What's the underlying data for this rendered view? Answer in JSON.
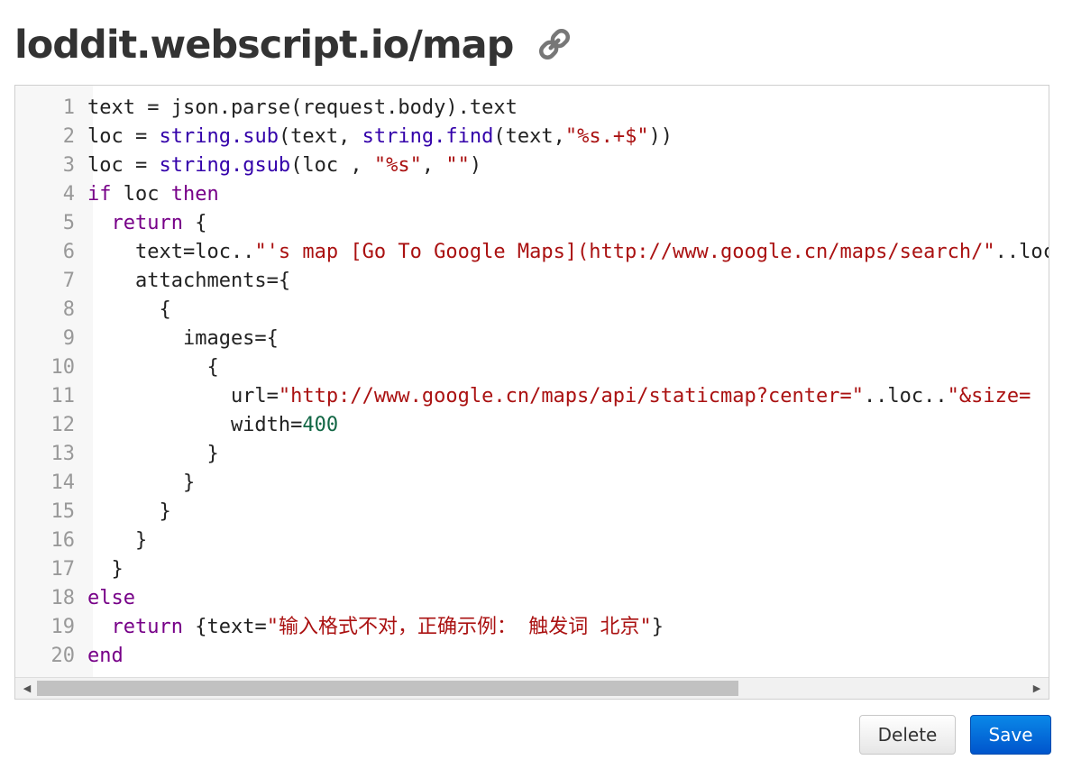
{
  "header": {
    "title": "loddit.webscript.io/map",
    "link_icon": "link-icon"
  },
  "editor": {
    "line_numbers": [
      "1",
      "2",
      "3",
      "4",
      "5",
      "6",
      "7",
      "8",
      "9",
      "10",
      "11",
      "12",
      "13",
      "14",
      "15",
      "16",
      "17",
      "18",
      "19",
      "20"
    ],
    "lines": [
      [
        {
          "t": "text = json.parse(request.body).text",
          "c": ""
        }
      ],
      [
        {
          "t": "loc = ",
          "c": ""
        },
        {
          "t": "string.sub",
          "c": "fn"
        },
        {
          "t": "(text, ",
          "c": ""
        },
        {
          "t": "string.find",
          "c": "fn"
        },
        {
          "t": "(text,",
          "c": ""
        },
        {
          "t": "\"%s.+$\"",
          "c": "str"
        },
        {
          "t": "))",
          "c": ""
        }
      ],
      [
        {
          "t": "loc = ",
          "c": ""
        },
        {
          "t": "string.gsub",
          "c": "fn"
        },
        {
          "t": "(loc , ",
          "c": ""
        },
        {
          "t": "\"%s\"",
          "c": "str"
        },
        {
          "t": ", ",
          "c": ""
        },
        {
          "t": "\"\"",
          "c": "str"
        },
        {
          "t": ")",
          "c": ""
        }
      ],
      [
        {
          "t": "if",
          "c": "kw"
        },
        {
          "t": " loc ",
          "c": ""
        },
        {
          "t": "then",
          "c": "kw"
        }
      ],
      [
        {
          "t": "  ",
          "c": ""
        },
        {
          "t": "return",
          "c": "kw"
        },
        {
          "t": " {",
          "c": ""
        }
      ],
      [
        {
          "t": "    text=loc..",
          "c": ""
        },
        {
          "t": "\"'s map [Go To Google Maps](http://www.google.cn/maps/search/\"",
          "c": "str"
        },
        {
          "t": "..loc..",
          "c": ""
        }
      ],
      [
        {
          "t": "    attachments={",
          "c": ""
        }
      ],
      [
        {
          "t": "      {",
          "c": ""
        }
      ],
      [
        {
          "t": "        images={",
          "c": ""
        }
      ],
      [
        {
          "t": "          {",
          "c": ""
        }
      ],
      [
        {
          "t": "            url=",
          "c": ""
        },
        {
          "t": "\"http://www.google.cn/maps/api/staticmap?center=\"",
          "c": "str"
        },
        {
          "t": "..loc..",
          "c": ""
        },
        {
          "t": "\"&size=",
          "c": "str"
        }
      ],
      [
        {
          "t": "            width=",
          "c": ""
        },
        {
          "t": "400",
          "c": "num"
        }
      ],
      [
        {
          "t": "          }",
          "c": ""
        }
      ],
      [
        {
          "t": "        }",
          "c": ""
        }
      ],
      [
        {
          "t": "      }",
          "c": ""
        }
      ],
      [
        {
          "t": "    }",
          "c": ""
        }
      ],
      [
        {
          "t": "  }",
          "c": ""
        }
      ],
      [
        {
          "t": "else",
          "c": "kw"
        }
      ],
      [
        {
          "t": "  ",
          "c": ""
        },
        {
          "t": "return",
          "c": "kw"
        },
        {
          "t": " {text=",
          "c": ""
        },
        {
          "t": "\"输入格式不对，正确示例： 触发词 北京\"",
          "c": "str"
        },
        {
          "t": "}",
          "c": ""
        }
      ],
      [
        {
          "t": "end",
          "c": "kw"
        }
      ]
    ]
  },
  "scrollbar": {
    "left_arrow": "◀",
    "right_arrow": "▶"
  },
  "actions": {
    "delete_label": "Delete",
    "save_label": "Save"
  },
  "colors": {
    "keyword": "#770088",
    "function": "#3300aa",
    "string": "#aa1111",
    "number": "#116644",
    "save_button": "#0066dd"
  }
}
